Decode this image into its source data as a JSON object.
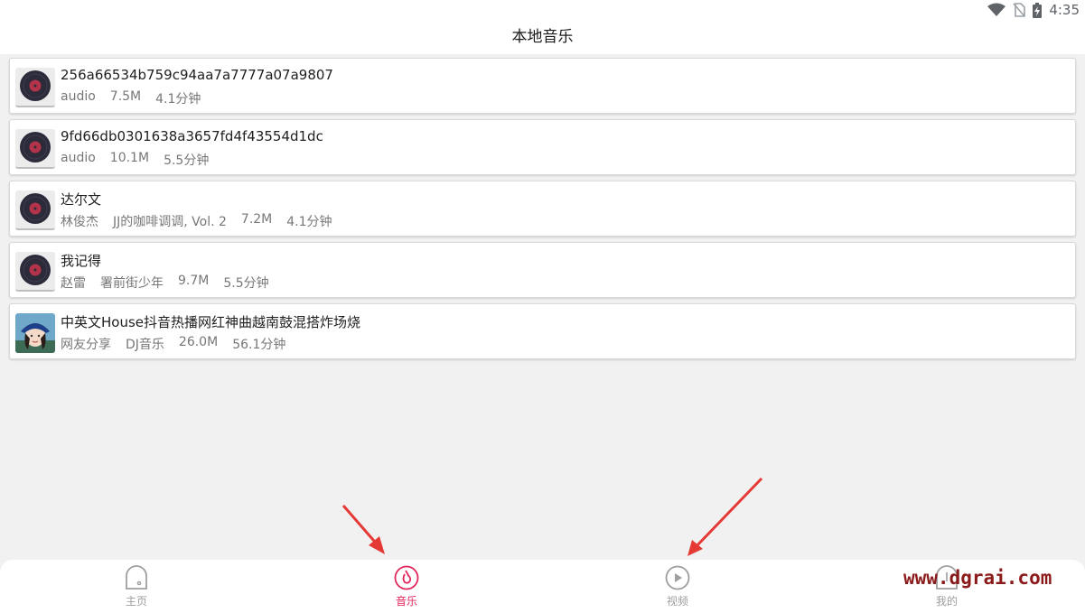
{
  "status_bar": {
    "time": "4:35"
  },
  "header": {
    "title": "本地音乐"
  },
  "songs": [
    {
      "title": "256a66534b759c94aa7a7777a07a9807",
      "meta": [
        "audio",
        "7.5M",
        "4.1分钟"
      ],
      "cover": "vinyl-icon"
    },
    {
      "title": "9fd66db0301638a3657fd4f43554d1dc",
      "meta": [
        "audio",
        "10.1M",
        "5.5分钟"
      ],
      "cover": "vinyl-icon"
    },
    {
      "title": "达尔文",
      "meta": [
        "林俊杰",
        "JJ的咖啡调调, Vol. 2",
        "7.2M",
        "4.1分钟"
      ],
      "cover": "vinyl-icon"
    },
    {
      "title": "我记得",
      "meta": [
        "赵雷",
        "署前街少年",
        "9.7M",
        "5.5分钟"
      ],
      "cover": "vinyl-icon"
    },
    {
      "title": "中英文House抖音热播网红神曲越南鼓混搭炸场烧",
      "meta": [
        "网友分享",
        "DJ音乐",
        "26.0M",
        "56.1分钟"
      ],
      "cover": "album-photo"
    }
  ],
  "nav": {
    "home": "主页",
    "music": "音乐",
    "video": "视频",
    "mine": "我的",
    "active_color": "#e3265c",
    "inactive_color": "#9e9e9e"
  },
  "watermark": "www.dgrai.com"
}
